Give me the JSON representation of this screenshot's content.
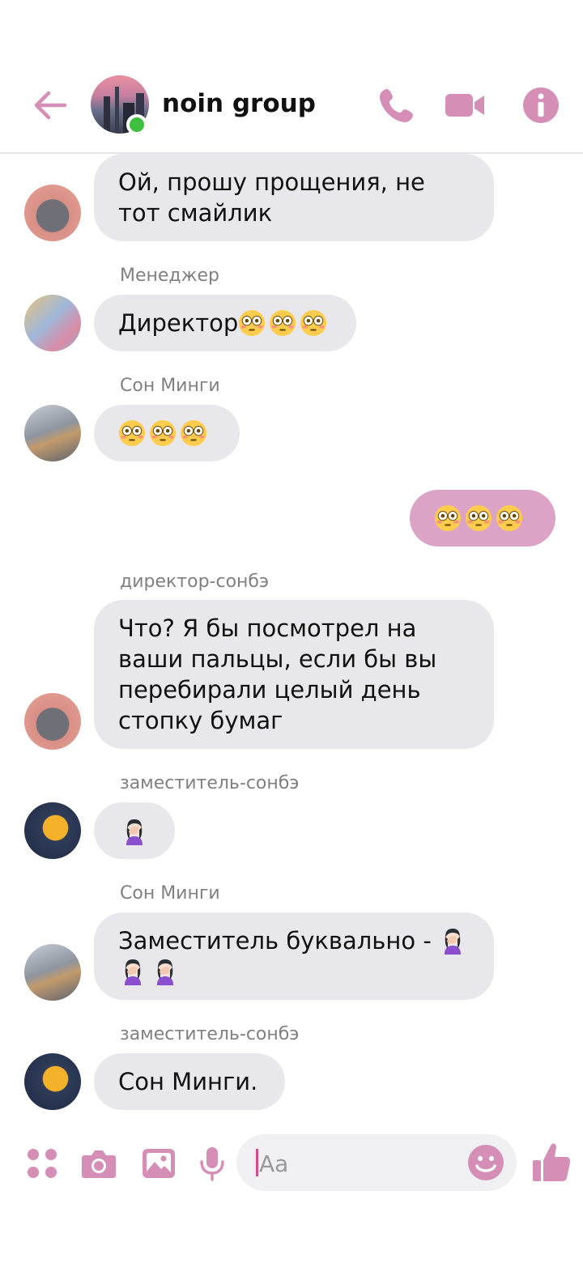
{
  "header": {
    "title": "noin group",
    "accent_color": "#d58fb6",
    "status": "online"
  },
  "messages": [
    {
      "sender_label": "",
      "text": "Ой, прошу прощения, не тот смайлик",
      "direction": "in",
      "avatar": "tom-cat"
    },
    {
      "sender_label": "Менеджер",
      "text": "Директор",
      "emoji": [
        "flushed-face",
        "flushed-face",
        "flushed-face"
      ],
      "direction": "in",
      "avatar": "group-photo"
    },
    {
      "sender_label": "Сон Минги",
      "emoji": [
        "flushed-face",
        "flushed-face",
        "flushed-face"
      ],
      "direction": "in",
      "avatar": "street-photo"
    },
    {
      "sender_label": "",
      "emoji": [
        "flushed-face",
        "flushed-face",
        "flushed-face"
      ],
      "direction": "out"
    },
    {
      "sender_label": "директор-сонбэ",
      "text": "Что? Я бы посмотрел на ваши пальцы, если бы вы перебирали целый день стопку бумаг",
      "direction": "in",
      "avatar": "tom-cat"
    },
    {
      "sender_label": "заместитель-сонбэ",
      "emoji": [
        "facepalm"
      ],
      "direction": "in",
      "avatar": "bart"
    },
    {
      "sender_label": "Сон Минги",
      "text": "Заместитель буквально -",
      "emoji": [
        "facepalm",
        "facepalm",
        "facepalm"
      ],
      "direction": "in",
      "avatar": "street-photo"
    },
    {
      "sender_label": "заместитель-сонбэ",
      "text": "Сон Минги.",
      "direction": "in",
      "avatar": "bart"
    }
  ],
  "composer": {
    "placeholder": "Aa",
    "icons": [
      "apps-icon",
      "camera-icon",
      "gallery-icon",
      "mic-icon",
      "emoji-icon",
      "thumbs-up-icon"
    ]
  }
}
